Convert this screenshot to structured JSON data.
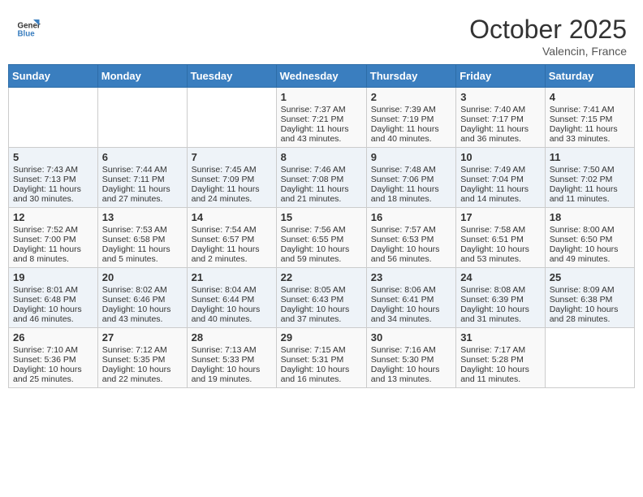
{
  "header": {
    "logo_line1": "General",
    "logo_line2": "Blue",
    "month": "October 2025",
    "location": "Valencin, France"
  },
  "days_of_week": [
    "Sunday",
    "Monday",
    "Tuesday",
    "Wednesday",
    "Thursday",
    "Friday",
    "Saturday"
  ],
  "weeks": [
    [
      {
        "day": "",
        "info": ""
      },
      {
        "day": "",
        "info": ""
      },
      {
        "day": "",
        "info": ""
      },
      {
        "day": "1",
        "info": "Sunrise: 7:37 AM\nSunset: 7:21 PM\nDaylight: 11 hours and 43 minutes."
      },
      {
        "day": "2",
        "info": "Sunrise: 7:39 AM\nSunset: 7:19 PM\nDaylight: 11 hours and 40 minutes."
      },
      {
        "day": "3",
        "info": "Sunrise: 7:40 AM\nSunset: 7:17 PM\nDaylight: 11 hours and 36 minutes."
      },
      {
        "day": "4",
        "info": "Sunrise: 7:41 AM\nSunset: 7:15 PM\nDaylight: 11 hours and 33 minutes."
      }
    ],
    [
      {
        "day": "5",
        "info": "Sunrise: 7:43 AM\nSunset: 7:13 PM\nDaylight: 11 hours and 30 minutes."
      },
      {
        "day": "6",
        "info": "Sunrise: 7:44 AM\nSunset: 7:11 PM\nDaylight: 11 hours and 27 minutes."
      },
      {
        "day": "7",
        "info": "Sunrise: 7:45 AM\nSunset: 7:09 PM\nDaylight: 11 hours and 24 minutes."
      },
      {
        "day": "8",
        "info": "Sunrise: 7:46 AM\nSunset: 7:08 PM\nDaylight: 11 hours and 21 minutes."
      },
      {
        "day": "9",
        "info": "Sunrise: 7:48 AM\nSunset: 7:06 PM\nDaylight: 11 hours and 18 minutes."
      },
      {
        "day": "10",
        "info": "Sunrise: 7:49 AM\nSunset: 7:04 PM\nDaylight: 11 hours and 14 minutes."
      },
      {
        "day": "11",
        "info": "Sunrise: 7:50 AM\nSunset: 7:02 PM\nDaylight: 11 hours and 11 minutes."
      }
    ],
    [
      {
        "day": "12",
        "info": "Sunrise: 7:52 AM\nSunset: 7:00 PM\nDaylight: 11 hours and 8 minutes."
      },
      {
        "day": "13",
        "info": "Sunrise: 7:53 AM\nSunset: 6:58 PM\nDaylight: 11 hours and 5 minutes."
      },
      {
        "day": "14",
        "info": "Sunrise: 7:54 AM\nSunset: 6:57 PM\nDaylight: 11 hours and 2 minutes."
      },
      {
        "day": "15",
        "info": "Sunrise: 7:56 AM\nSunset: 6:55 PM\nDaylight: 10 hours and 59 minutes."
      },
      {
        "day": "16",
        "info": "Sunrise: 7:57 AM\nSunset: 6:53 PM\nDaylight: 10 hours and 56 minutes."
      },
      {
        "day": "17",
        "info": "Sunrise: 7:58 AM\nSunset: 6:51 PM\nDaylight: 10 hours and 53 minutes."
      },
      {
        "day": "18",
        "info": "Sunrise: 8:00 AM\nSunset: 6:50 PM\nDaylight: 10 hours and 49 minutes."
      }
    ],
    [
      {
        "day": "19",
        "info": "Sunrise: 8:01 AM\nSunset: 6:48 PM\nDaylight: 10 hours and 46 minutes."
      },
      {
        "day": "20",
        "info": "Sunrise: 8:02 AM\nSunset: 6:46 PM\nDaylight: 10 hours and 43 minutes."
      },
      {
        "day": "21",
        "info": "Sunrise: 8:04 AM\nSunset: 6:44 PM\nDaylight: 10 hours and 40 minutes."
      },
      {
        "day": "22",
        "info": "Sunrise: 8:05 AM\nSunset: 6:43 PM\nDaylight: 10 hours and 37 minutes."
      },
      {
        "day": "23",
        "info": "Sunrise: 8:06 AM\nSunset: 6:41 PM\nDaylight: 10 hours and 34 minutes."
      },
      {
        "day": "24",
        "info": "Sunrise: 8:08 AM\nSunset: 6:39 PM\nDaylight: 10 hours and 31 minutes."
      },
      {
        "day": "25",
        "info": "Sunrise: 8:09 AM\nSunset: 6:38 PM\nDaylight: 10 hours and 28 minutes."
      }
    ],
    [
      {
        "day": "26",
        "info": "Sunrise: 7:10 AM\nSunset: 5:36 PM\nDaylight: 10 hours and 25 minutes."
      },
      {
        "day": "27",
        "info": "Sunrise: 7:12 AM\nSunset: 5:35 PM\nDaylight: 10 hours and 22 minutes."
      },
      {
        "day": "28",
        "info": "Sunrise: 7:13 AM\nSunset: 5:33 PM\nDaylight: 10 hours and 19 minutes."
      },
      {
        "day": "29",
        "info": "Sunrise: 7:15 AM\nSunset: 5:31 PM\nDaylight: 10 hours and 16 minutes."
      },
      {
        "day": "30",
        "info": "Sunrise: 7:16 AM\nSunset: 5:30 PM\nDaylight: 10 hours and 13 minutes."
      },
      {
        "day": "31",
        "info": "Sunrise: 7:17 AM\nSunset: 5:28 PM\nDaylight: 10 hours and 11 minutes."
      },
      {
        "day": "",
        "info": ""
      }
    ]
  ]
}
